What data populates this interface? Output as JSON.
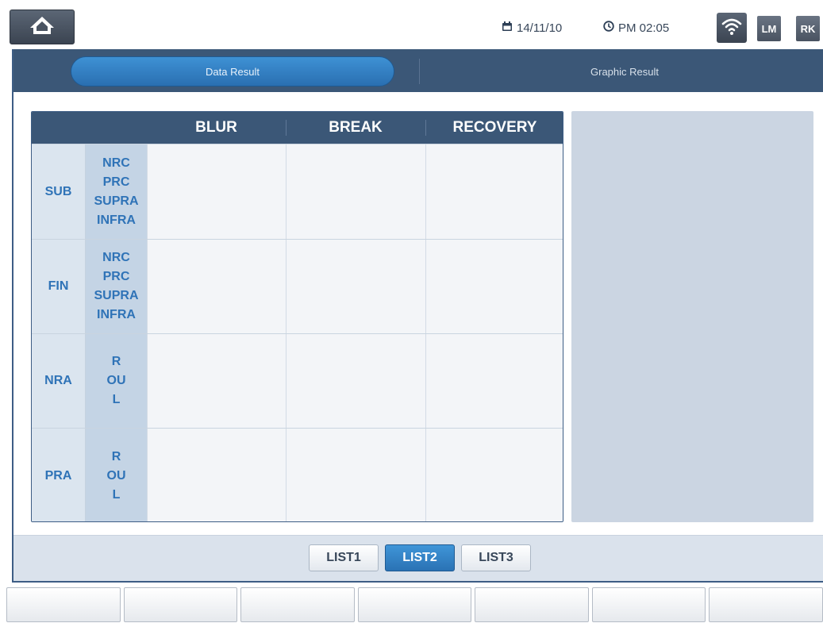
{
  "status_bar": {
    "date": "14/11/10",
    "time": "PM 02:05",
    "badges": [
      "LM",
      "RK"
    ]
  },
  "tabs": [
    {
      "label": "Data Result",
      "active": true
    },
    {
      "label": "Graphic Result",
      "active": false
    }
  ],
  "table": {
    "columns": [
      "BLUR",
      "BREAK",
      "RECOVERY"
    ],
    "rows": [
      {
        "group": "SUB",
        "subs": [
          "NRC",
          "PRC",
          "SUPRA",
          "INFRA"
        ],
        "values": [
          "",
          "",
          ""
        ]
      },
      {
        "group": "FIN",
        "subs": [
          "NRC",
          "PRC",
          "SUPRA",
          "INFRA"
        ],
        "values": [
          "",
          "",
          ""
        ]
      },
      {
        "group": "NRA",
        "subs": [
          "R",
          "OU",
          "L"
        ],
        "values": [
          "",
          "",
          ""
        ]
      },
      {
        "group": "PRA",
        "subs": [
          "R",
          "OU",
          "L"
        ],
        "values": [
          "",
          "",
          ""
        ]
      }
    ]
  },
  "list_buttons": [
    {
      "label": "LIST1",
      "active": false
    },
    {
      "label": "LIST2",
      "active": true
    },
    {
      "label": "LIST3",
      "active": false
    }
  ],
  "soft_keys": [
    "",
    "",
    "",
    "",
    "",
    "",
    ""
  ],
  "colors": {
    "header": "#3b5777",
    "accent": "#2f7fc4",
    "label_text": "#2f73b7",
    "panel": "#cbd5e2"
  }
}
